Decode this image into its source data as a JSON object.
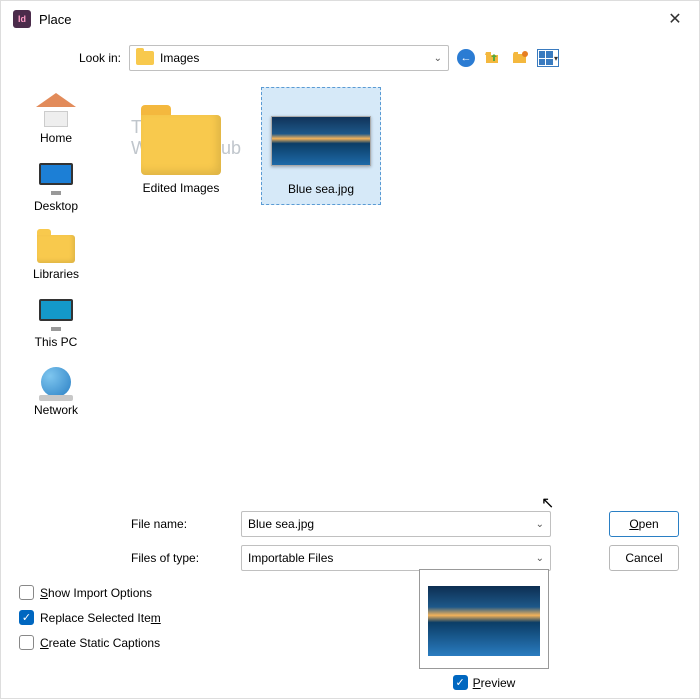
{
  "window": {
    "title": "Place",
    "app_icon_text": "Id"
  },
  "lookin": {
    "label": "Look in:",
    "value": "Images"
  },
  "toolbar": {
    "back": "←",
    "up": "↑",
    "newfolder": "📁",
    "views_caret": "▾"
  },
  "sidebar": {
    "items": [
      {
        "label": "Home"
      },
      {
        "label": "Desktop"
      },
      {
        "label": "Libraries"
      },
      {
        "label": "This PC"
      },
      {
        "label": "Network"
      }
    ]
  },
  "watermark": {
    "line1": "The",
    "line2": "WindowsClub"
  },
  "files": [
    {
      "name": "Edited Images",
      "type": "folder"
    },
    {
      "name": "Blue sea.jpg",
      "type": "image"
    }
  ],
  "fields": {
    "filename_label": "File name:",
    "filename_value": "Blue sea.jpg",
    "filetype_label": "Files of type:",
    "filetype_value": "Importable Files"
  },
  "buttons": {
    "open": "Open",
    "cancel": "Cancel"
  },
  "checks": {
    "show_import": "Show Import Options",
    "replace": "Replace Selected Item",
    "captions": "Create Static Captions",
    "preview": "Preview"
  }
}
